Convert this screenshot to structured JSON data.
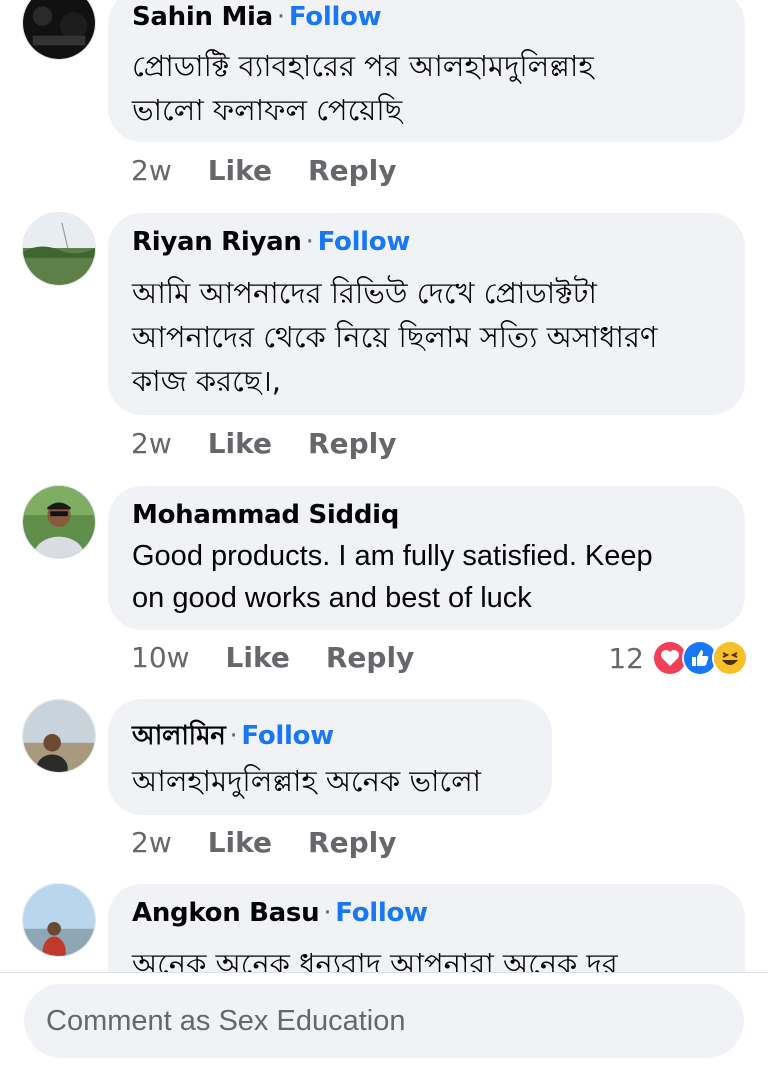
{
  "comments": [
    {
      "name": "Sahin Mia",
      "follow": "Follow",
      "lines": [
        "প্রোডাক্টি ব্যাবহারের পর আলহামদুলিল্লাহ",
        "ভালো ফলাফল পেয়েছি"
      ],
      "time": "2w",
      "like": "Like",
      "reply": "Reply"
    },
    {
      "name": "Riyan Riyan",
      "follow": "Follow",
      "lines": [
        "আমি আপনাদের রিভিউ দেখে প্রোডাক্টটা",
        "আপনাদের থেকে নিয়ে ছিলাম সত্যি অসাধারণ",
        "কাজ করছে।,"
      ],
      "time": "2w",
      "like": "Like",
      "reply": "Reply"
    },
    {
      "name": "Mohammad Siddiq",
      "lines": [
        "Good products. I am fully satisfied. Keep",
        "on good works and best of luck"
      ],
      "time": "10w",
      "like": "Like",
      "reply": "Reply",
      "reaction_count": "12",
      "reaction_icons": [
        "love-icon",
        "like-icon",
        "haha-icon"
      ]
    },
    {
      "name": "আলামিন",
      "follow": "Follow",
      "lines": [
        "আলহামদুলিল্লাহ অনেক  ভালো"
      ],
      "time": "2w",
      "like": "Like",
      "reply": "Reply"
    },
    {
      "name": "Angkon Basu",
      "follow": "Follow",
      "lines": [
        "অনেক অনেক ধন্যবাদ আপনারা অনেক দর"
      ]
    }
  ],
  "composer": {
    "placeholder": "Comment as Sex Education"
  },
  "colors": {
    "bubble": "#f0f2f5",
    "follow": "#1877f2",
    "meta": "#65676b"
  }
}
